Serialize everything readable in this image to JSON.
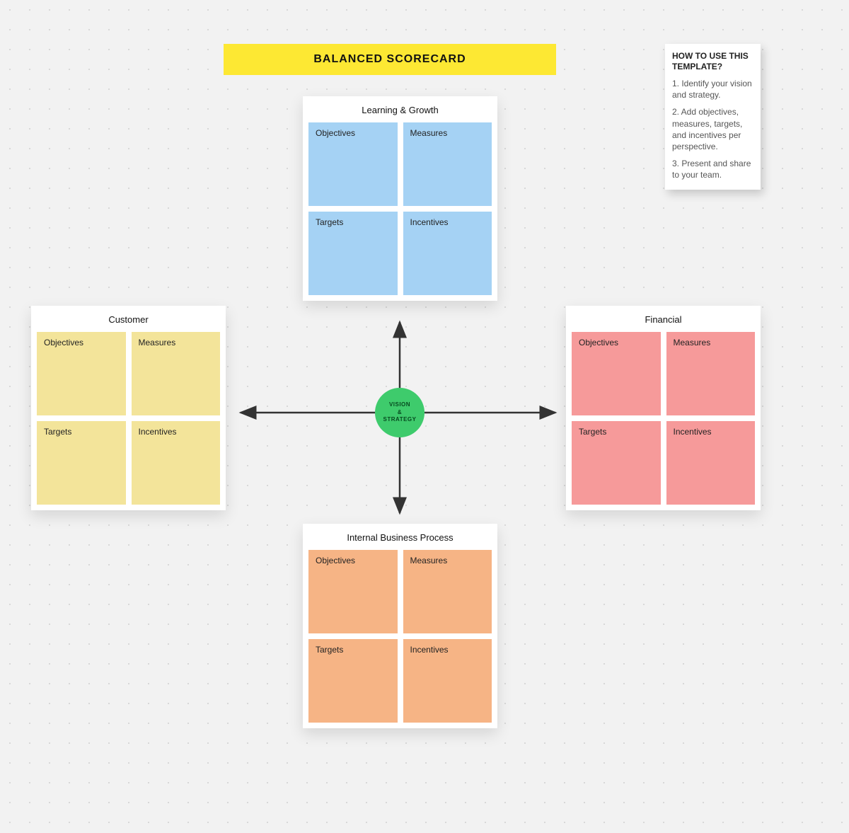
{
  "title": "BALANCED SCORECARD",
  "center": {
    "line1": "VISION",
    "line2": "&",
    "line3": "STRATEGY"
  },
  "help": {
    "title": "HOW TO USE THIS TEMPLATE?",
    "steps": [
      "1. Identify your vision and strategy.",
      "2. Add objectives, measures, targets, and incentives per perspective.",
      "3. Present and share to your team."
    ]
  },
  "panels": {
    "top": {
      "title": "Learning & Growth",
      "cells": [
        "Objectives",
        "Measures",
        "Targets",
        "Incentives"
      ],
      "color": "#a5d2f4"
    },
    "left": {
      "title": "Customer",
      "cells": [
        "Objectives",
        "Measures",
        "Targets",
        "Incentives"
      ],
      "color": "#f3e49a"
    },
    "right": {
      "title": "Financial",
      "cells": [
        "Objectives",
        "Measures",
        "Targets",
        "Incentives"
      ],
      "color": "#f69a9a"
    },
    "bottom": {
      "title": "Internal Business Process",
      "cells": [
        "Objectives",
        "Measures",
        "Targets",
        "Incentives"
      ],
      "color": "#f6b485"
    }
  }
}
